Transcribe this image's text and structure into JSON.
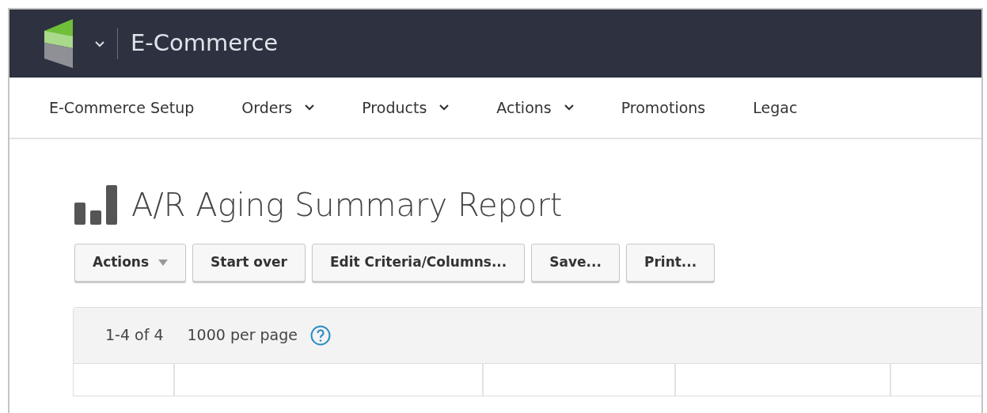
{
  "app": {
    "title": "E-Commerce"
  },
  "nav": [
    {
      "label": "E-Commerce Setup",
      "dropdown": false
    },
    {
      "label": "Orders",
      "dropdown": true
    },
    {
      "label": "Products",
      "dropdown": true
    },
    {
      "label": "Actions",
      "dropdown": true
    },
    {
      "label": "Promotions",
      "dropdown": false
    },
    {
      "label": "Legac",
      "dropdown": false
    }
  ],
  "page_title": "A/R Aging Summary Report",
  "toolbar": [
    {
      "label": "Actions",
      "kind": "dropdown"
    },
    {
      "label": "Start over",
      "kind": "button"
    },
    {
      "label": "Edit Criteria/Columns...",
      "kind": "button"
    },
    {
      "label": "Save...",
      "kind": "button"
    },
    {
      "label": "Print...",
      "kind": "button"
    }
  ],
  "grid": {
    "range": "1-4 of 4",
    "per_page": "1000 per page"
  }
}
